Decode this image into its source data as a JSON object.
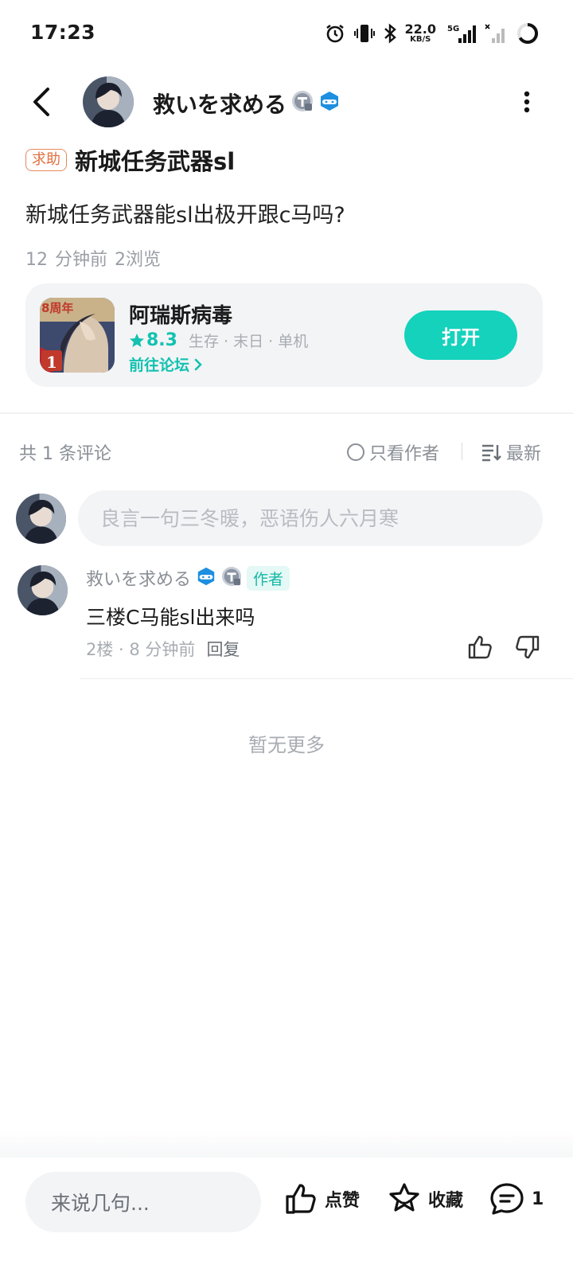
{
  "status_bar": {
    "time": "17:23",
    "net_speed_value": "22.0",
    "net_speed_unit": "KB/S",
    "network": "5G",
    "icons": [
      "alarm-icon",
      "vibrate-icon",
      "bluetooth-icon",
      "signal-5g-icon",
      "signal-sim2-icon",
      "battery-ring-icon"
    ]
  },
  "header": {
    "username": "救いを求める",
    "badges": [
      "level-badge-icon",
      "gamepad-badge-icon"
    ]
  },
  "post": {
    "tag": "求助",
    "title": "新城任务武器sl",
    "body": "新城任务武器能sl出极开跟c马吗?",
    "time": "12 分钟前",
    "views": "2浏览"
  },
  "game_card": {
    "name": "阿瑞斯病毒",
    "score": "8.3",
    "tags": "生存 · 末日 · 单机",
    "forum_link": "前往论坛",
    "open_button": "打开",
    "icon_badge_text": "8周年",
    "icon_rank": "1"
  },
  "comments": {
    "count_label": "共 1 条评论",
    "author_only_label": "只看作者",
    "sort_label": "最新",
    "input_placeholder": "良言一句三冬暖，恶语伤人六月寒",
    "items": [
      {
        "username": "救いを求める",
        "author_badge": "作者",
        "text": "三楼C马能sl出来吗",
        "floor": "2楼 · 8 分钟前",
        "reply_label": "回复"
      }
    ],
    "no_more": "暂无更多"
  },
  "bottom_bar": {
    "reply_placeholder": "来说几句...",
    "like_label": "点赞",
    "favorite_label": "收藏",
    "comment_count": "1"
  },
  "colors": {
    "accent": "#14d2bc",
    "tag_help": "#e07040",
    "muted_text": "#8a8f96"
  }
}
